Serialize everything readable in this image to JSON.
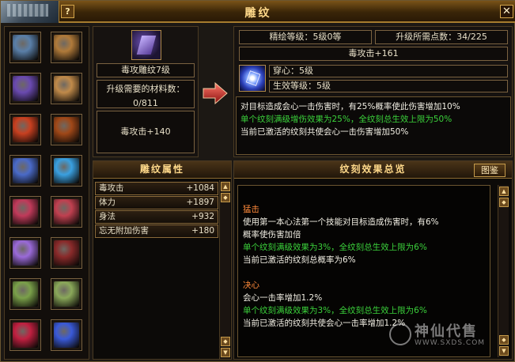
{
  "window": {
    "title": "雕纹",
    "help_label": "?",
    "close_label": "✕"
  },
  "slots": [
    {
      "icon": "purple-blade-icon",
      "color": "#5a7fa8"
    },
    {
      "icon": "bronze-ring-icon",
      "color": "#b07a3a"
    },
    {
      "icon": "armor-icon",
      "color": "#6a4ab0"
    },
    {
      "icon": "gold-ring-icon",
      "color": "#c08a4a"
    },
    {
      "icon": "helmet-icon",
      "color": "#c84020"
    },
    {
      "icon": "bracer-icon",
      "color": "#a04818"
    },
    {
      "icon": "shoulder-icon",
      "color": "#4a6ac8"
    },
    {
      "icon": "feather-blade-icon",
      "color": "#3aa0e0"
    },
    {
      "icon": "robe-icon",
      "color": "#c03a5a"
    },
    {
      "icon": "glove-icon",
      "color": "#c04050"
    },
    {
      "icon": "sword-icon",
      "color": "#9a6ad8"
    },
    {
      "icon": "boots-icon",
      "color": "#8a2a2a"
    },
    {
      "icon": "jade-pendant-icon",
      "color": "#7aa04a"
    },
    {
      "icon": "jade-pendant-2-icon",
      "color": "#8aa85a"
    },
    {
      "icon": "ruby-necklace-icon",
      "color": "#c02040"
    },
    {
      "icon": "blue-ornament-icon",
      "color": "#3a5ad8"
    }
  ],
  "item": {
    "name": "毒攻雕纹7级",
    "materials_label": "升级需要的材料数：",
    "materials_value": "0/811",
    "current_bonus": "毒攻击+140"
  },
  "upgrade": {
    "refine_level": "精绘等级：5级0等",
    "points_needed": "升级所需点数：34/225",
    "next_bonus": "毒攻击+161",
    "attr_line": "穿心：5级",
    "effect_line": "生效等级：5级",
    "desc": [
      {
        "text": "对目标造成会心一击伤害时，有25%概率使此伤害增加10%",
        "color": "white"
      },
      {
        "text": "单个纹刻满级增伤效果为25%，全纹刻总生效上限为50%",
        "color": "green"
      },
      {
        "text": "当前已激活的纹刻共使会心一击伤害增加50%",
        "color": "white"
      }
    ]
  },
  "attributes": {
    "title": "雕纹属性",
    "rows": [
      {
        "name": "毒攻击",
        "value": "+1084"
      },
      {
        "name": "体力",
        "value": "+1897"
      },
      {
        "name": "身法",
        "value": "+932"
      },
      {
        "name": "忘无附加伤害",
        "value": "+180"
      }
    ]
  },
  "effects": {
    "title": "纹刻效果总览",
    "atlas_label": "图鉴",
    "blocks": [
      {
        "title": "猛击",
        "lines": [
          {
            "text": "使用第一本心法第一个技能对目标造成伤害时，有6%",
            "color": "white"
          },
          {
            "text": "概率使伤害加倍",
            "color": "white"
          },
          {
            "text": "单个纹刻满级效果为3%，全纹刻总生效上限为6%",
            "color": "green"
          },
          {
            "text": "当前已激活的纹刻总概率为6%",
            "color": "white"
          }
        ]
      },
      {
        "title": "决心",
        "lines": [
          {
            "text": "会心一击率增加1.2%",
            "color": "white"
          },
          {
            "text": "单个纹刻满级效果为3%，全纹刻总生效上限为6%",
            "color": "green"
          },
          {
            "text": "当前已激活的纹刻共使会心一击率增加1.2%",
            "color": "white"
          }
        ]
      }
    ]
  },
  "watermark": {
    "main": "神仙代售",
    "url": "WWW.SXDS.COM"
  }
}
